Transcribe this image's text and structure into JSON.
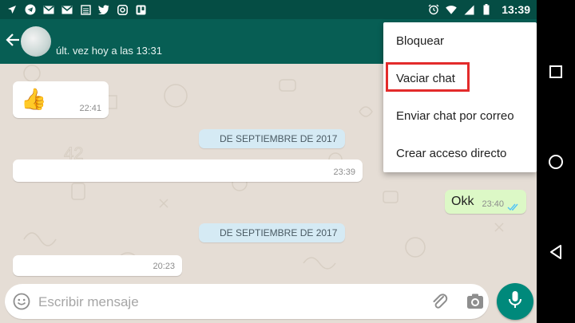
{
  "header": {
    "last_seen": "últ. vez hoy a las 13:31"
  },
  "statusbar": {
    "time": "13:39"
  },
  "messages": [
    {
      "time": "22:41",
      "content": "👍"
    },
    {
      "time": "23:39"
    },
    {
      "text": "Okk",
      "time": "23:40"
    },
    {
      "time": "20:23"
    }
  ],
  "dates": [
    "DE SEPTIEMBRE DE 2017",
    "DE SEPTIEMBRE DE 2017"
  ],
  "menu": {
    "items": [
      "Bloquear",
      "Vaciar chat",
      "Enviar chat por correo",
      "Crear acceso directo"
    ]
  },
  "input": {
    "placeholder": "Escribir mensaje"
  },
  "colors": {
    "header": "#075e54",
    "statusbar": "#054d44",
    "highlight": "#e32b2b",
    "outgoing": "#dcf8c6",
    "fab": "#00897b"
  }
}
